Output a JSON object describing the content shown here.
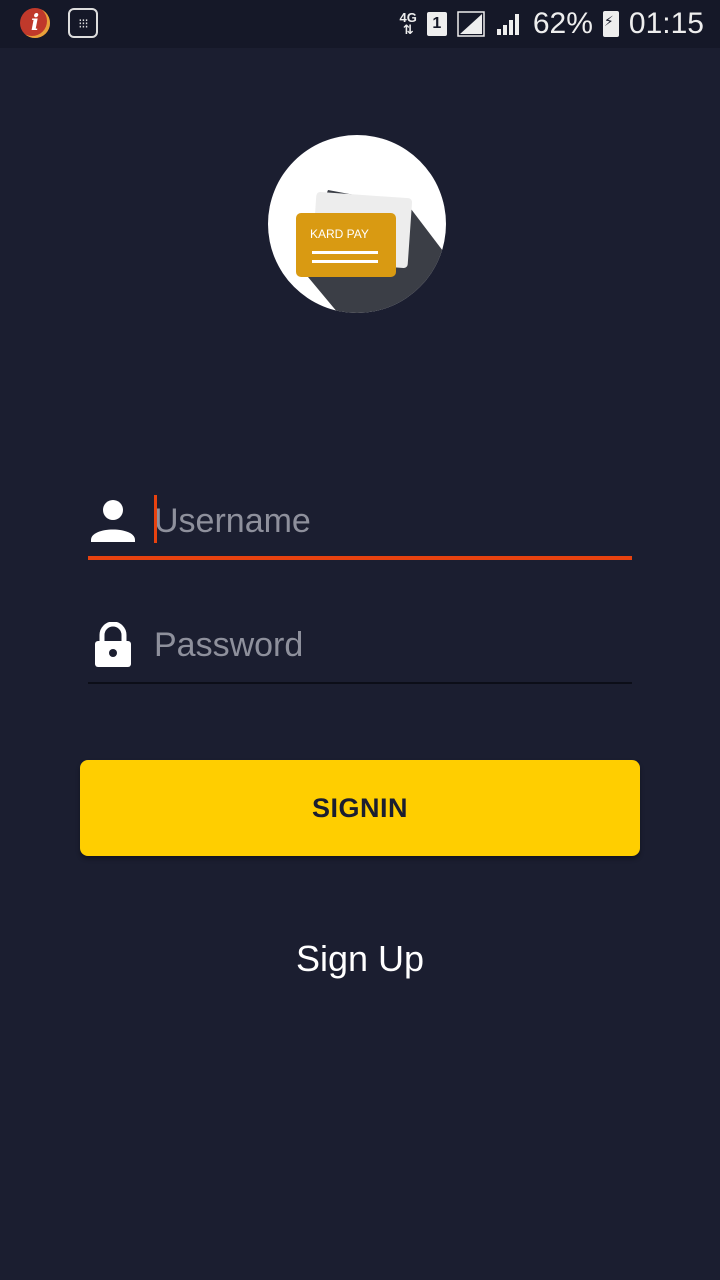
{
  "status_bar": {
    "network_type": "4G",
    "sim_slot": "1",
    "battery_percent": "62%",
    "time": "01:15",
    "icons": [
      "info-app-icon",
      "calculator-icon",
      "4g-data-icon",
      "sim-icon",
      "signal-icon",
      "signal-icon",
      "battery-charging-icon"
    ]
  },
  "logo": {
    "brand_text": "KARD PAY",
    "card_color": "#d99a12"
  },
  "form": {
    "username": {
      "placeholder": "Username",
      "value": "",
      "icon": "user-icon"
    },
    "password": {
      "placeholder": "Password",
      "value": "",
      "icon": "lock-icon"
    }
  },
  "signin_label": "SIGNIN",
  "signup_label": "Sign Up",
  "colors": {
    "background": "#1b1e30",
    "accent": "#ffce00",
    "focus_underline": "#e8420f"
  }
}
